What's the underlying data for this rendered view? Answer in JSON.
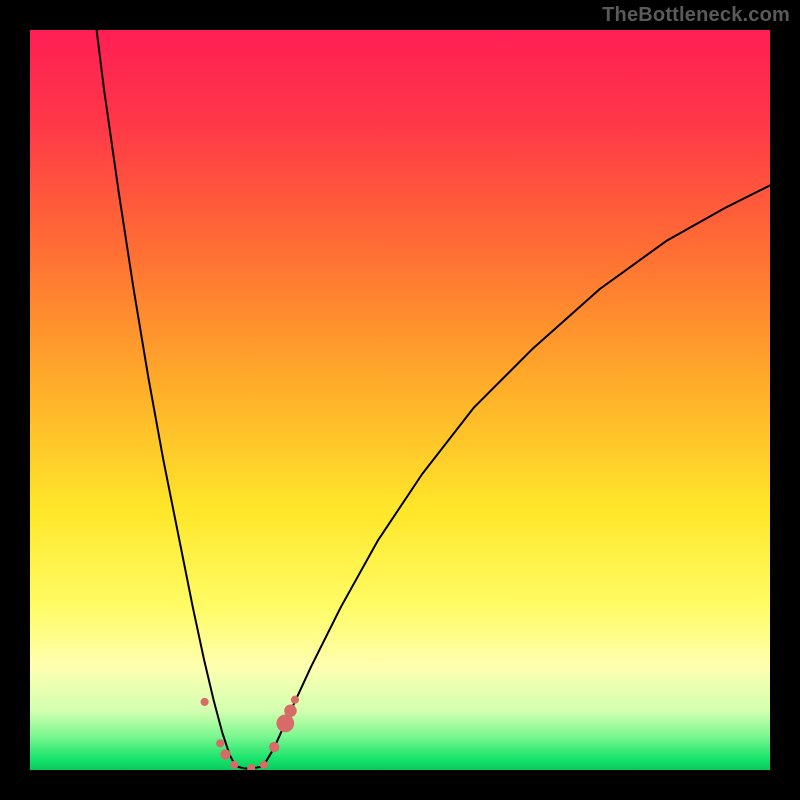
{
  "watermark": "TheBottleneck.com",
  "colors": {
    "frame": "#000000",
    "watermark": "#5a5a5a",
    "curve": "#000000",
    "marker": "#d66b67",
    "gradient_stops": [
      {
        "offset": 0.0,
        "color": "#ff1f55"
      },
      {
        "offset": 0.12,
        "color": "#ff3648"
      },
      {
        "offset": 0.3,
        "color": "#ff6f33"
      },
      {
        "offset": 0.5,
        "color": "#ffb429"
      },
      {
        "offset": 0.65,
        "color": "#ffe72a"
      },
      {
        "offset": 0.78,
        "color": "#fffc66"
      },
      {
        "offset": 0.86,
        "color": "#ffffb0"
      },
      {
        "offset": 0.92,
        "color": "#d3ffb0"
      },
      {
        "offset": 0.955,
        "color": "#79f78f"
      },
      {
        "offset": 0.985,
        "color": "#18e36b"
      },
      {
        "offset": 1.0,
        "color": "#06c95d"
      }
    ]
  },
  "chart_data": {
    "type": "line",
    "title": "",
    "xlabel": "",
    "ylabel": "",
    "xlim": [
      0,
      100
    ],
    "ylim": [
      0,
      100
    ],
    "grid": false,
    "legend": false,
    "series": [
      {
        "name": "left-branch",
        "x": [
          9,
          10,
          12,
          14,
          16,
          18,
          20,
          22,
          23.5,
          24.8,
          26,
          27,
          27.8
        ],
        "y": [
          100,
          92,
          78,
          65,
          53,
          42,
          32,
          22,
          15,
          9.5,
          5,
          2,
          0.5
        ]
      },
      {
        "name": "right-branch",
        "x": [
          31.5,
          33,
          35,
          38,
          42,
          47,
          53,
          60,
          68,
          77,
          86,
          94,
          100
        ],
        "y": [
          0.5,
          3,
          7.5,
          14,
          22,
          31,
          40,
          49,
          57,
          65,
          71.5,
          76,
          79
        ]
      },
      {
        "name": "valley-floor",
        "x": [
          27.8,
          29,
          30,
          31.5
        ],
        "y": [
          0.5,
          0.2,
          0.2,
          0.5
        ]
      }
    ],
    "markers": [
      {
        "x": 23.6,
        "y": 9.2,
        "r": 0.55
      },
      {
        "x": 25.7,
        "y": 3.6,
        "r": 0.55
      },
      {
        "x": 26.4,
        "y": 2.1,
        "r": 0.7
      },
      {
        "x": 27.6,
        "y": 0.7,
        "r": 0.55
      },
      {
        "x": 29.9,
        "y": 0.25,
        "r": 0.55
      },
      {
        "x": 31.6,
        "y": 0.7,
        "r": 0.55
      },
      {
        "x": 33.0,
        "y": 3.1,
        "r": 0.7
      },
      {
        "x": 34.5,
        "y": 6.3,
        "r": 1.2
      },
      {
        "x": 35.2,
        "y": 8.0,
        "r": 0.85
      },
      {
        "x": 35.8,
        "y": 9.5,
        "r": 0.55
      }
    ]
  }
}
